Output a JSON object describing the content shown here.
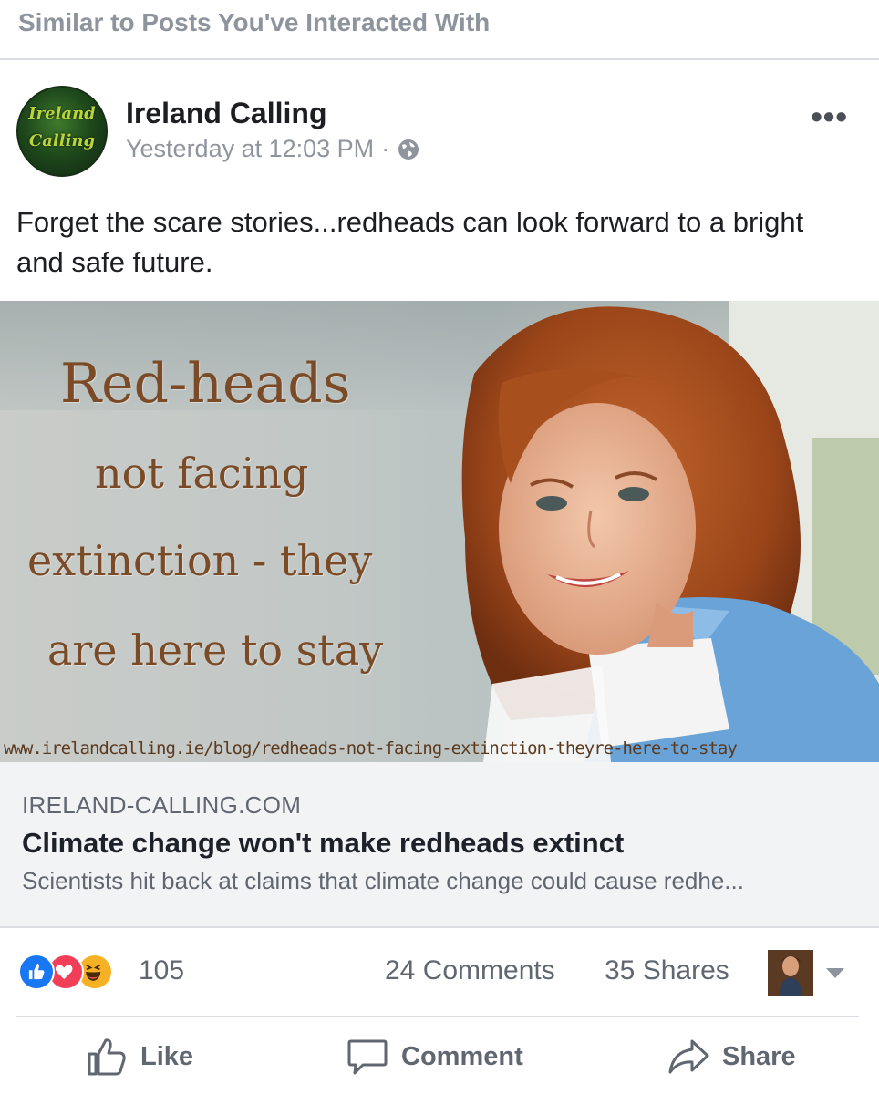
{
  "section": {
    "title": "Similar to Posts You've Interacted With"
  },
  "post": {
    "author": "Ireland Calling",
    "avatar_text": [
      "Ireland",
      "Calling"
    ],
    "timestamp": "Yesterday at 12:03 PM",
    "separator": "·",
    "privacy_icon": "globe-icon",
    "more_label": "•••",
    "text": "Forget the scare stories...redheads can look forward to a bright and safe future."
  },
  "link": {
    "image_text": {
      "line1": "Red-heads",
      "line2": "not facing",
      "line3": "extinction - they",
      "line4": "are here to stay",
      "url": "www.irelandcalling.ie/blog/redheads-not-facing-extinction-theyre-here-to-stay"
    },
    "domain": "IRELAND-CALLING.COM",
    "title": "Climate change won't make redheads extinct",
    "description": "Scientists hit back at claims that climate change could cause redhe..."
  },
  "stats": {
    "reactions": [
      "like-icon",
      "love-icon",
      "haha-icon"
    ],
    "reaction_count": "105",
    "comments": "24 Comments",
    "shares": "35 Shares"
  },
  "actions": {
    "like": "Like",
    "comment": "Comment",
    "share": "Share"
  },
  "colors": {
    "like": "#1877f2",
    "love": "#f33e58",
    "haha": "#f7b125",
    "muted": "#606770"
  }
}
